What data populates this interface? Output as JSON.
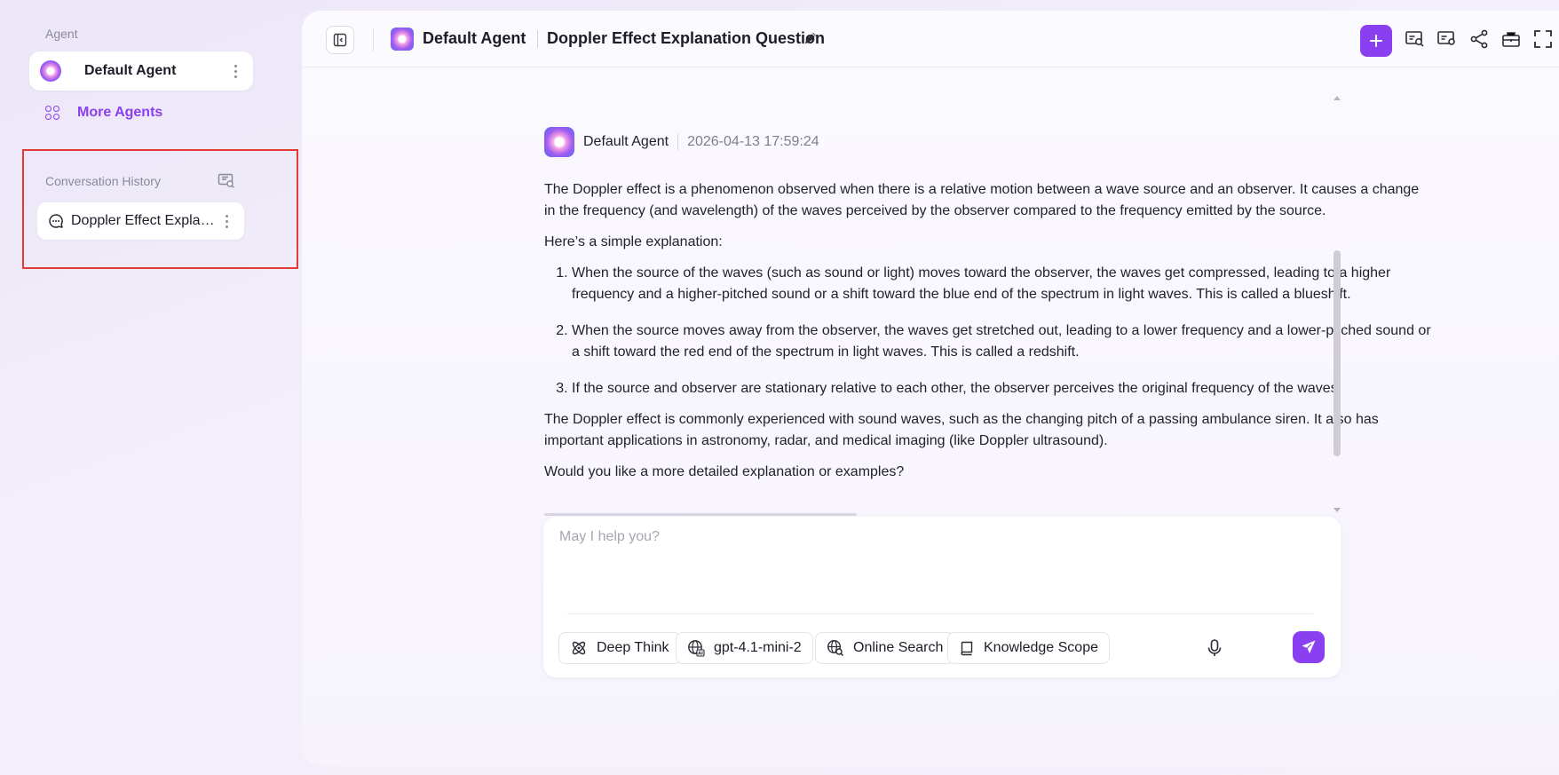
{
  "sidebar": {
    "agent_section_label": "Agent",
    "current_agent": "Default Agent",
    "more_agents_label": "More Agents",
    "history_label": "Conversation History",
    "history_items": [
      {
        "title": "Doppler Effect Explanation Question"
      }
    ]
  },
  "header": {
    "agent_name": "Default Agent",
    "conversation_title": "Doppler Effect Explanation Question"
  },
  "message": {
    "agent_name": "Default Agent",
    "timestamp": "2026-04-13 17:59:24",
    "intro": "The Doppler effect is a phenomenon observed when there is a relative motion between a wave source and an observer. It causes a change in the frequency (and wavelength) of the waves perceived by the observer compared to the frequency emitted by the source.",
    "lead": "Here’s a simple explanation:",
    "points": [
      "When the source of the waves (such as sound or light) moves toward the observer, the waves get compressed, leading to a higher frequency and a higher-pitched sound or a shift toward the blue end of the spectrum in light waves. This is called a blueshift.",
      "When the source moves away from the observer, the waves get stretched out, leading to a lower frequency and a lower-pitched sound or a shift toward the red end of the spectrum in light waves. This is called a redshift.",
      "If the source and observer are stationary relative to each other, the observer perceives the original frequency of the waves."
    ],
    "summary": "The Doppler effect is commonly experienced with sound waves, such as the changing pitch of a passing ambulance siren. It also has important applications in astronomy, radar, and medical imaging (like Doppler ultrasound).",
    "question": "Would you like a more detailed explanation or examples?"
  },
  "composer": {
    "placeholder": "May I help you?",
    "deep_think_label": "Deep Think",
    "model_label": "gpt-4.1-mini-2",
    "online_search_label": "Online Search",
    "knowledge_scope_label": "Knowledge Scope"
  },
  "colors": {
    "accent": "#8a3ff0",
    "annotation_red": "#e53935"
  },
  "icons": {
    "toggle": "sidebar-toggle-icon",
    "edit": "pencil-icon",
    "add": "plus-icon",
    "history_search": "chat-search-icon",
    "share": "share-icon",
    "fullscreen": "fullscreen-icon",
    "mic": "microphone-icon",
    "send": "send-icon"
  }
}
